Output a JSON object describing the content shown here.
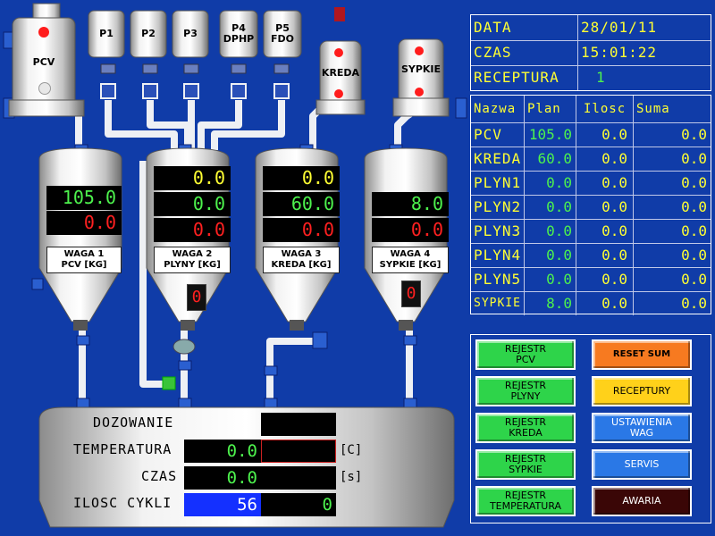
{
  "hoppers": {
    "pcv": {
      "label": "PCV"
    },
    "p1": {
      "label": "P1"
    },
    "p2": {
      "label": "P2"
    },
    "p3": {
      "label": "P3"
    },
    "p4": {
      "label": "P4\nDPHP"
    },
    "p5": {
      "label": "P5\nFDO"
    },
    "kreda": {
      "label": "KREDA"
    },
    "sypkie": {
      "label": "SYPKIE"
    }
  },
  "scales": [
    {
      "values": [
        "105.0",
        "0.0"
      ],
      "label": "WAGA 1\nPCV [KG]"
    },
    {
      "values": [
        "0.0",
        "0.0",
        "0.0"
      ],
      "label": "WAGA 2\nPLYNY [KG]",
      "counter": "0"
    },
    {
      "values": [
        "0.0",
        "60.0",
        "0.0"
      ],
      "label": "WAGA 3\nKREDA [KG]"
    },
    {
      "values": [
        "8.0",
        "0.0"
      ],
      "label": "WAGA 4\nSYPKIE [KG]",
      "counter": "0"
    }
  ],
  "info": {
    "data_label": "DATA",
    "data_value": "28/01/11",
    "czas_label": "CZAS",
    "czas_value": "15:01:22",
    "receptura_label": "RECEPTURA",
    "receptura_value": "1"
  },
  "table": {
    "headers": [
      "Nazwa",
      "Plan",
      "Ilosc",
      "Suma"
    ],
    "rows": [
      [
        "PCV",
        "105.0",
        "0.0",
        "0.0"
      ],
      [
        "KREDA",
        "60.0",
        "0.0",
        "0.0"
      ],
      [
        "PLYN1",
        "0.0",
        "0.0",
        "0.0"
      ],
      [
        "PLYN2",
        "0.0",
        "0.0",
        "0.0"
      ],
      [
        "PLYN3",
        "0.0",
        "0.0",
        "0.0"
      ],
      [
        "PLYN4",
        "0.0",
        "0.0",
        "0.0"
      ],
      [
        "PLYN5",
        "0.0",
        "0.0",
        "0.0"
      ],
      [
        "SYPKIE",
        "8.0",
        "0.0",
        "0.0"
      ]
    ]
  },
  "buttons": {
    "rejestr_pcv": "REJESTR\nPCV",
    "reset_sum": "RESET SUM",
    "rejestr_plyny": "REJESTR\nPLYNY",
    "receptury": "RECEPTURY",
    "rejestr_kreda": "REJESTR\nKREDA",
    "ustawienia_wag": "USTAWIENIA\nWAG",
    "rejestr_sypkie": "REJESTR\nSYPKIE",
    "servis": "SERVIS",
    "rejestr_temperatura": "REJESTR\nTEMPERATURA",
    "awaria": "AWARIA"
  },
  "mixer": {
    "dozowanie_label": "DOZOWANIE",
    "temperatura_label": "TEMPERATURA",
    "temperatura_value": "0.0",
    "temperatura_unit": "[C]",
    "czas_label": "CZAS",
    "czas_value": "0.0",
    "czas_unit": "[s]",
    "cykle_label": "ILOSC CYKLI",
    "cykle_value": "56",
    "cykle_value2": "0"
  },
  "colors": {
    "background": "#103ca8",
    "display_green": "#4df24d",
    "display_red": "#ff2020",
    "display_yellow": "#ffff33"
  }
}
